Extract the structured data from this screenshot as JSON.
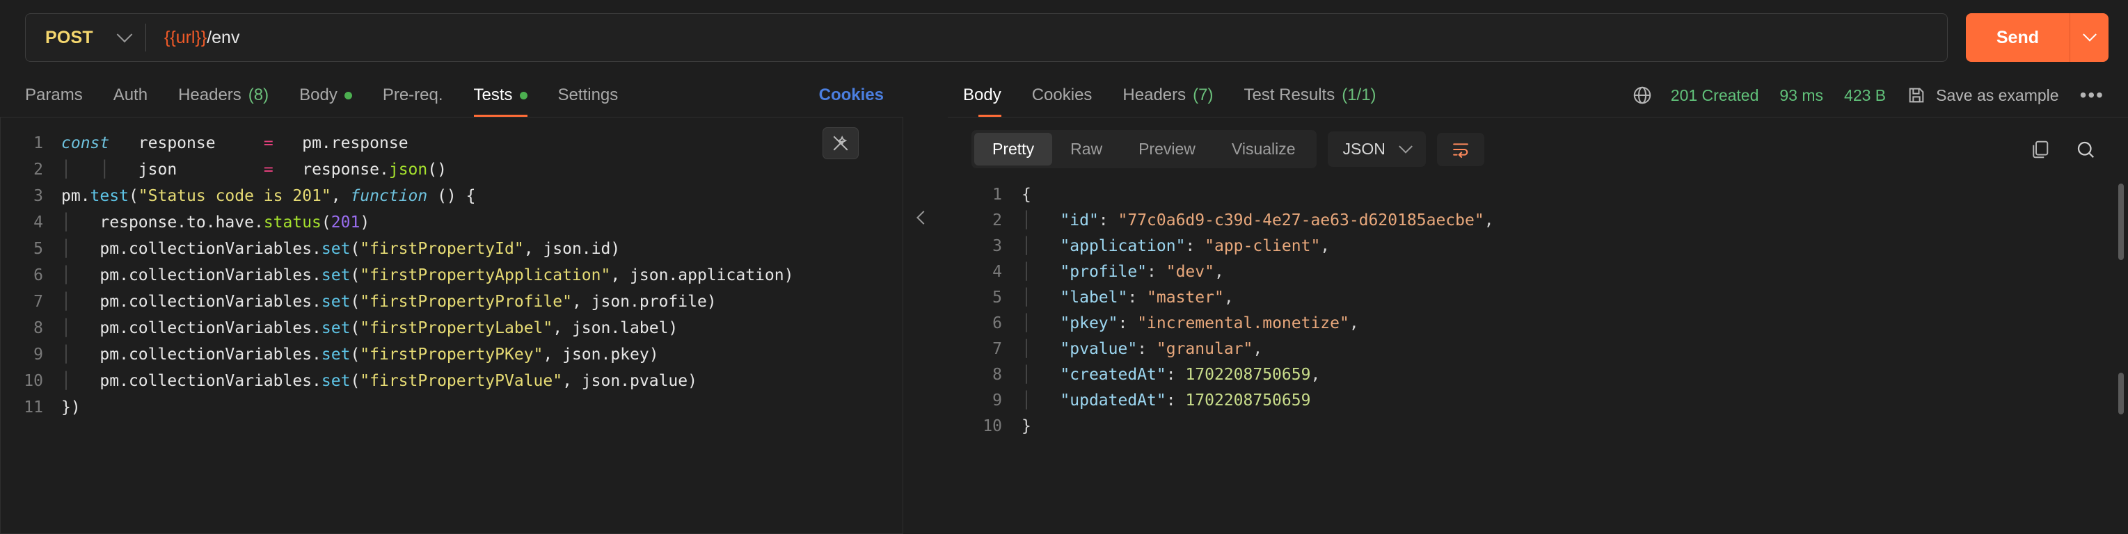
{
  "request": {
    "method": "POST",
    "method_caret": "chevron-down",
    "url_variable": "{{url}}",
    "url_path": "/env",
    "url_full": "{{url}}/env",
    "send_label": "Send",
    "tabs": [
      {
        "label": "Params",
        "badge": "",
        "dot": false,
        "active": false
      },
      {
        "label": "Auth",
        "badge": "",
        "dot": false,
        "active": false
      },
      {
        "label": "Headers",
        "badge": "(8)",
        "dot": false,
        "active": false
      },
      {
        "label": "Body",
        "badge": "",
        "dot": true,
        "active": false
      },
      {
        "label": "Pre-req.",
        "badge": "",
        "dot": false,
        "active": false
      },
      {
        "label": "Tests",
        "badge": "",
        "dot": true,
        "active": true
      },
      {
        "label": "Settings",
        "badge": "",
        "dot": false,
        "active": false
      }
    ],
    "cookies_link": "Cookies"
  },
  "code": {
    "lines": [
      {
        "n": "1",
        "text": "const   response   =   pm.response"
      },
      {
        "n": "2",
        "text": "        json       =   response.json()"
      },
      {
        "n": "3",
        "text": "pm.test(\"Status code is 201\", function () {"
      },
      {
        "n": "4",
        "text": "    response.to.have.status(201)"
      },
      {
        "n": "5",
        "text": "    pm.collectionVariables.set(\"firstPropertyId\", json.id)"
      },
      {
        "n": "6",
        "text": "    pm.collectionVariables.set(\"firstPropertyApplication\", json.application)"
      },
      {
        "n": "7",
        "text": "    pm.collectionVariables.set(\"firstPropertyProfile\", json.profile)"
      },
      {
        "n": "8",
        "text": "    pm.collectionVariables.set(\"firstPropertyLabel\", json.label)"
      },
      {
        "n": "9",
        "text": "    pm.collectionVariables.set(\"firstPropertyPKey\", json.pkey)"
      },
      {
        "n": "10",
        "text": "    pm.collectionVariables.set(\"firstPropertyPValue\", json.pvalue)"
      },
      {
        "n": "11",
        "text": "})"
      }
    ]
  },
  "response": {
    "tabs": [
      {
        "label": "Body",
        "badge": "",
        "active": true
      },
      {
        "label": "Cookies",
        "badge": "",
        "active": false
      },
      {
        "label": "Headers",
        "badge": "(7)",
        "active": false
      },
      {
        "label": "Test Results",
        "badge": "(1/1)",
        "active": false
      }
    ],
    "status_code": "201 Created",
    "time": "93 ms",
    "size": "423 B",
    "save_as_example": "Save as example",
    "more_label": "•••",
    "view_modes": [
      {
        "label": "Pretty",
        "active": true
      },
      {
        "label": "Raw",
        "active": false
      },
      {
        "label": "Preview",
        "active": false
      },
      {
        "label": "Visualize",
        "active": false
      }
    ],
    "format": "JSON",
    "body_lines": [
      {
        "n": "1",
        "kind": "punc",
        "key": "",
        "value": "{"
      },
      {
        "n": "2",
        "kind": "string",
        "key": "\"id\"",
        "value": "\"77c0a6d9-c39d-4e27-ae63-d620185aecbe\"",
        "comma": ","
      },
      {
        "n": "3",
        "kind": "string",
        "key": "\"application\"",
        "value": "\"app-client\"",
        "comma": ","
      },
      {
        "n": "4",
        "kind": "string",
        "key": "\"profile\"",
        "value": "\"dev\"",
        "comma": ","
      },
      {
        "n": "5",
        "kind": "string",
        "key": "\"label\"",
        "value": "\"master\"",
        "comma": ","
      },
      {
        "n": "6",
        "kind": "string",
        "key": "\"pkey\"",
        "value": "\"incremental.monetize\"",
        "comma": ","
      },
      {
        "n": "7",
        "kind": "string",
        "key": "\"pvalue\"",
        "value": "\"granular\"",
        "comma": ","
      },
      {
        "n": "8",
        "kind": "number",
        "key": "\"createdAt\"",
        "value": "1702208750659",
        "comma": ","
      },
      {
        "n": "9",
        "kind": "number",
        "key": "\"updatedAt\"",
        "value": "1702208750659",
        "comma": ""
      },
      {
        "n": "10",
        "kind": "punc",
        "key": "",
        "value": "}"
      }
    ]
  },
  "colors": {
    "accent": "#ff6c37",
    "method": "#f5d76e",
    "link": "#4b7fe0",
    "success": "#61c17a",
    "bg": "#1e1e1e"
  }
}
